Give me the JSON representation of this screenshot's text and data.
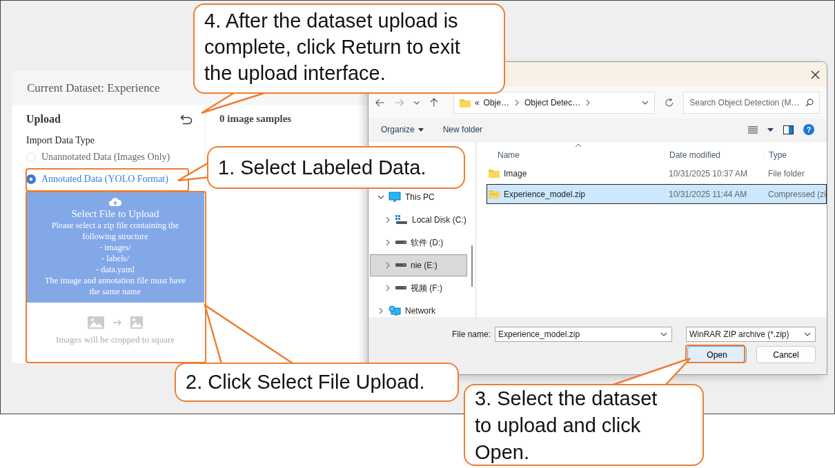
{
  "app": {
    "header_title": "Current Dataset: Experience",
    "section_title": "Upload",
    "samples_count": "0 image samples",
    "import_label": "Import Data Type",
    "options": [
      {
        "label": "Unannotated Data (Images Only)",
        "selected": false
      },
      {
        "label": "Annotated Data (YOLO Format)",
        "selected": true
      }
    ],
    "upload_box": {
      "title": "Select File to Upload",
      "lines": [
        "Please select a zip file containing the following structure",
        "- images/",
        "- labels/",
        "- data.yaml",
        "The image and annotation file must have the same name"
      ],
      "note": "Images will be cropped to square"
    }
  },
  "dialog": {
    "address_overflow": "«",
    "breadcrumb": [
      "Obje…",
      "Object Detec…"
    ],
    "search_placeholder": "Search Object Detection (M…",
    "toolbar": [
      "Organize",
      "New folder"
    ],
    "help_glyph": "?",
    "tree": [
      {
        "label": "This PC",
        "kind": "pc",
        "expanded": true,
        "selected": false,
        "children": [
          {
            "label": "Local Disk (C:)",
            "kind": "system-drive",
            "expanded": false,
            "selected": false
          },
          {
            "label": "软件 (D:)",
            "kind": "drive",
            "expanded": false,
            "selected": false
          },
          {
            "label": "nie (E:)",
            "kind": "drive",
            "expanded": false,
            "selected": true
          },
          {
            "label": "视频 (F:)",
            "kind": "drive",
            "expanded": false,
            "selected": false
          }
        ]
      },
      {
        "label": "Network",
        "kind": "network",
        "expanded": false,
        "selected": false
      }
    ],
    "columns": [
      "Name",
      "Date modified",
      "Type"
    ],
    "files": [
      {
        "name": "Image",
        "date": "10/31/2025 10:37 AM",
        "type": "File folder",
        "kind": "folder",
        "selected": false
      },
      {
        "name": "Experience_model.zip",
        "date": "10/31/2025 11:44 AM",
        "type": "Compressed (zi",
        "kind": "zip",
        "selected": true
      }
    ],
    "file_name_label": "File name:",
    "file_name_value": "Experience_model.zip",
    "file_type": "WinRAR ZIP archive (*.zip)",
    "buttons": [
      {
        "label": "Open",
        "kind": "primary"
      },
      {
        "label": "Cancel",
        "kind": "secondary"
      }
    ]
  },
  "callouts": [
    {
      "text": "4. After the dataset upload is complete, click Return to exit the upload interface."
    },
    {
      "text": "1. Select Labeled Data."
    },
    {
      "text": "2. Click Select File Upload."
    },
    {
      "text": "3. Select the dataset to upload and click Open."
    }
  ]
}
